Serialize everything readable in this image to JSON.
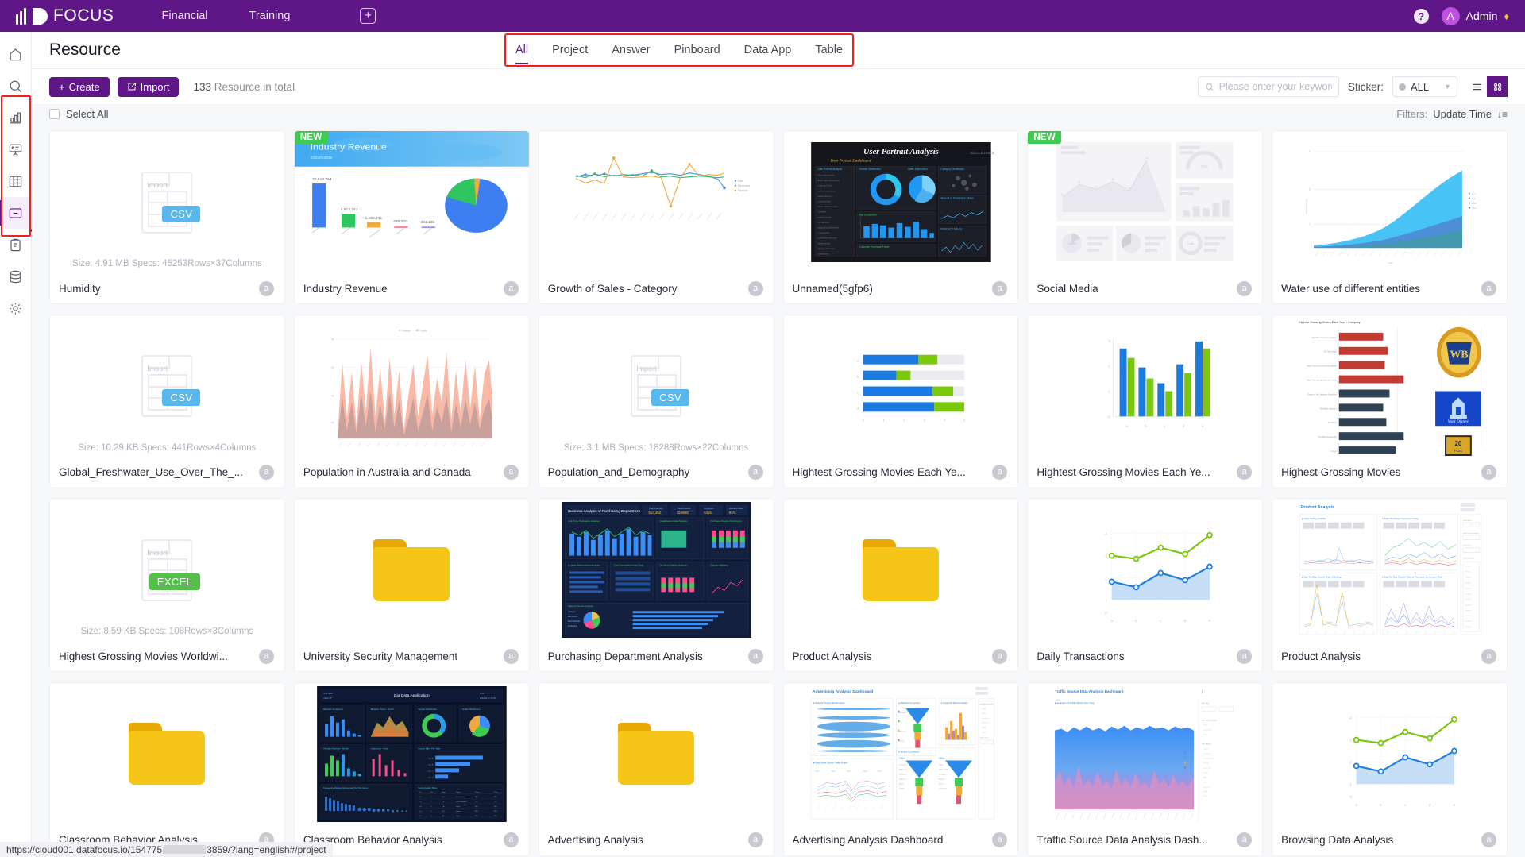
{
  "topbar": {
    "brand": "FOCUS",
    "nav": [
      {
        "label": "Financial"
      },
      {
        "label": "Training"
      }
    ],
    "add_label": "+",
    "help_label": "?",
    "avatar_initial": "A",
    "user_name": "Admin",
    "gem_icon": "♦"
  },
  "sidebar": {
    "items": [
      {
        "name": "home",
        "label": "Home"
      },
      {
        "name": "search",
        "label": "Search"
      },
      {
        "name": "chart",
        "label": "Chart"
      },
      {
        "name": "presentation",
        "label": "Pinboard"
      },
      {
        "name": "table",
        "label": "Table"
      },
      {
        "name": "resource",
        "label": "Resource"
      },
      {
        "name": "clipboard",
        "label": "Task"
      },
      {
        "name": "database",
        "label": "Data Source"
      },
      {
        "name": "settings",
        "label": "Settings"
      }
    ],
    "tooltip": "Resource"
  },
  "header": {
    "title": "Resource",
    "tabs": [
      {
        "label": "All",
        "active": true
      },
      {
        "label": "Project",
        "active": false
      },
      {
        "label": "Answer",
        "active": false
      },
      {
        "label": "Pinboard",
        "active": false
      },
      {
        "label": "Data App",
        "active": false
      },
      {
        "label": "Table",
        "active": false
      }
    ]
  },
  "toolbar": {
    "create_label": "Create",
    "create_icon": "+",
    "import_label": "Import",
    "import_icon": "import-icon",
    "total_count": "133",
    "total_suffix": "Resource in total",
    "search_placeholder": "Please enter your keywords",
    "search_value": "",
    "sticker_label": "Sticker:",
    "sticker_value": "ALL",
    "view_list_icon": "list-view-icon",
    "view_grid_icon": "grid-view-icon"
  },
  "selectrow": {
    "select_all_label": "Select All",
    "filters_label": "Filters:",
    "filter_value": "Update Time",
    "sort_icon": "sort-descending-icon"
  },
  "cards": [
    {
      "name": "Humidity",
      "badge": "a",
      "thumb": "file-csv",
      "new": false,
      "specs": "Size: 4.91 MB   Specs:  45253Rows×37Columns"
    },
    {
      "name": "Industry Revenue",
      "badge": "a",
      "thumb": "industry-revenue",
      "new": true,
      "banner_title": "Industry Revenue",
      "banner_sub": "2022/03/06"
    },
    {
      "name": "Growth of Sales - Category",
      "badge": "a",
      "thumb": "line-multi",
      "new": false
    },
    {
      "name": "Unnamed(5gfp6)",
      "badge": "a",
      "thumb": "user-portrait",
      "new": false,
      "dash_title": "User Portrait Analysis"
    },
    {
      "name": "Social Media",
      "badge": "a",
      "thumb": "social-media",
      "new": true
    },
    {
      "name": "Water use of different entities",
      "badge": "a",
      "thumb": "water-area",
      "new": false
    },
    {
      "name": "Global_Freshwater_Use_Over_The_...",
      "badge": "a",
      "thumb": "file-csv",
      "new": false,
      "specs": "Size: 10.29 KB   Specs:  441Rows×4Columns"
    },
    {
      "name": "Population in Australia and Canada",
      "badge": "a",
      "thumb": "population-area",
      "new": false
    },
    {
      "name": "Population_and_Demography",
      "badge": "a",
      "thumb": "file-csv",
      "new": false,
      "specs": "Size: 3.1 MB   Specs:  18288Rows×22Columns"
    },
    {
      "name": "Hightest Grossing Movies Each Ye...",
      "badge": "a",
      "thumb": "hbar-stacked",
      "new": false
    },
    {
      "name": "Hightest Grossing Movies Each Ye...",
      "badge": "a",
      "thumb": "vbar-pairs",
      "new": false
    },
    {
      "name": "Highest Grossing Movies",
      "badge": "a",
      "thumb": "movies-bars",
      "new": false
    },
    {
      "name": "Highest Grossing Movies Worldwi...",
      "badge": "a",
      "thumb": "file-excel",
      "new": false,
      "specs": "Size: 8.59 KB   Specs:  108Rows×3Columns"
    },
    {
      "name": "University Security Management",
      "badge": "a",
      "thumb": "folder",
      "new": false
    },
    {
      "name": "Purchasing Department Analysis",
      "badge": "a",
      "thumb": "purchasing-dash",
      "new": false,
      "dash_title": "Business Analysis of Purchasing Department"
    },
    {
      "name": "Product Analysis",
      "badge": "a",
      "thumb": "folder",
      "new": false
    },
    {
      "name": "Daily Transactions",
      "badge": "a",
      "thumb": "line-area-2",
      "new": false
    },
    {
      "name": "Product Analysis",
      "badge": "a",
      "thumb": "product-dash",
      "new": false,
      "dash_title": "Product Analysis"
    },
    {
      "name": "Classroom Behavior Analysis",
      "badge": "a",
      "thumb": "folder",
      "new": false
    },
    {
      "name": "Classroom Behavior Analysis",
      "badge": "a",
      "thumb": "bigdata-dash",
      "new": false,
      "dash_title": "Big Data Application"
    },
    {
      "name": "Advertising Analysis",
      "badge": "a",
      "thumb": "folder",
      "new": false
    },
    {
      "name": "Advertising Analysis Dashboard",
      "badge": "a",
      "thumb": "advertising-dash",
      "new": false,
      "dash_title": "Advertising Analysis Dashboard"
    },
    {
      "name": "Traffic Source Data Analysis Dash...",
      "badge": "a",
      "thumb": "traffic-dash",
      "new": false,
      "dash_title": "Traffic Source Data Analysis Dashboard"
    },
    {
      "name": "Browsing Data Analysis",
      "badge": "a",
      "thumb": "line-area-2",
      "new": false
    }
  ],
  "statusbar": {
    "url_prefix": "https://cloud001.datafocus.io/154775",
    "url_suffix": "3859/?lang=english#/project"
  },
  "colors": {
    "brand_purple": "#5f1687",
    "highlight_red": "#ee2020",
    "badge_green": "#3fcb53",
    "csv_blue": "#58b8ee",
    "excel_green": "#54c04a",
    "folder_yellow": "#f5c518"
  }
}
